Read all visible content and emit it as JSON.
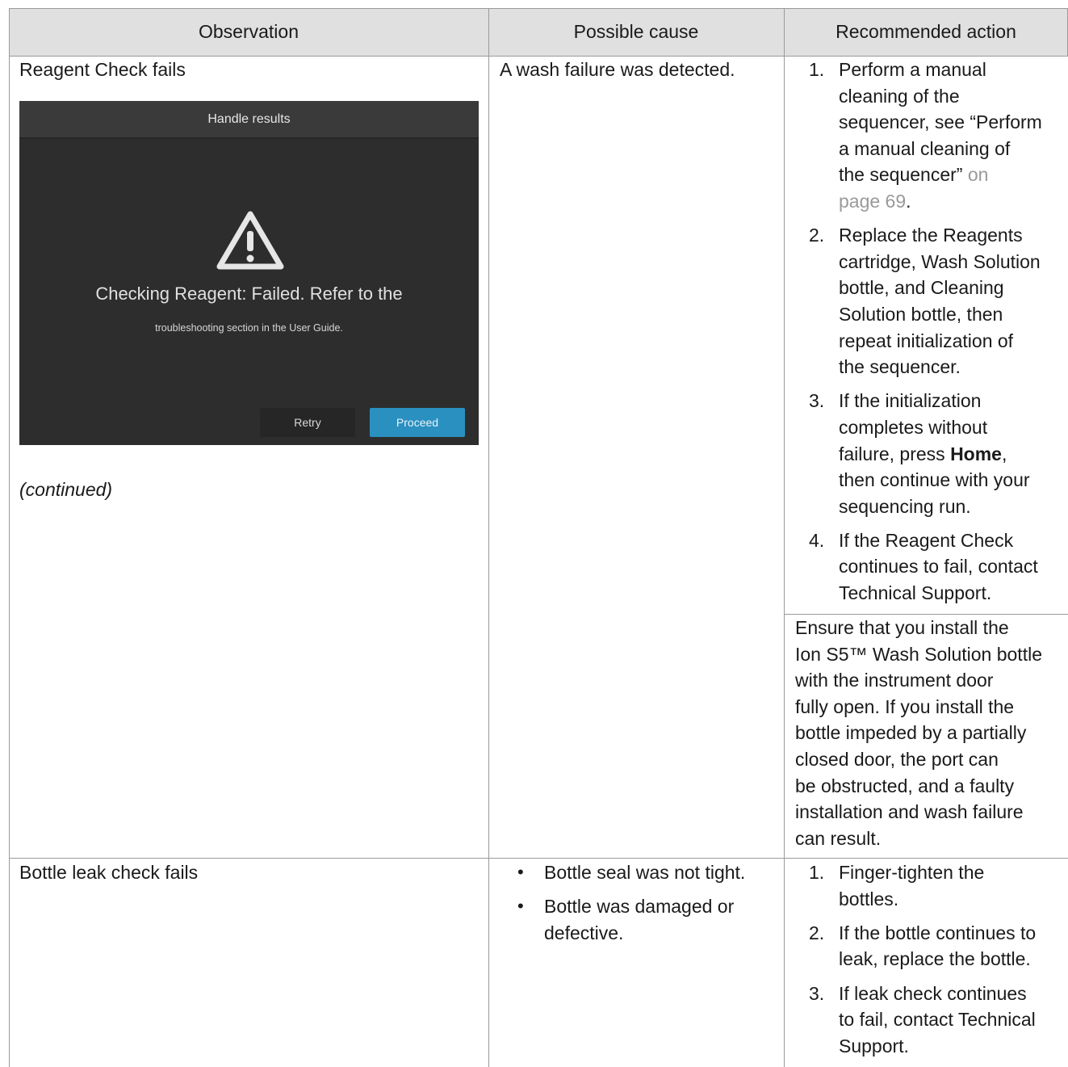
{
  "table": {
    "headers": [
      "Observation",
      "Possible cause",
      "Recommended action"
    ],
    "rows": [
      {
        "observation": "Reagent Check fails",
        "continued": "(continued)",
        "screenshot": {
          "title": "Handle results",
          "icon": "warning-triangle-icon",
          "message_line1": "Checking Reagent: Failed. Refer to the",
          "message_line2": "troubleshooting section in the User Guide.",
          "retry_label": "Retry",
          "proceed_label": "Proceed",
          "accent_color": "#2a90c0"
        },
        "cause": "A wash failure was detected.",
        "actions": [
          {
            "num": "1.",
            "lines": [
              "Perform a manual",
              "cleaning of the",
              "sequencer, see “Perform",
              "a manual cleaning of",
              "the sequencer”"
            ],
            "link_tail": " on",
            "link_line": "page 69",
            "end": "."
          },
          {
            "num": "2.",
            "lines": [
              "Replace the Reagents",
              "cartridge, Wash Solution",
              "bottle, and Cleaning",
              "Solution bottle, then",
              "repeat initialization of",
              "the sequencer."
            ]
          },
          {
            "num": "3.",
            "lines": [
              "If the initialization",
              "completes without"
            ],
            "line3_pre": "failure, press ",
            "line3_bold": "Home",
            "line3_post": ",",
            "lines_after": [
              "then continue with your",
              "sequencing run."
            ]
          },
          {
            "num": "4.",
            "lines": [
              "If the Reagent Check",
              "continues to fail, contact",
              "Technical Support."
            ]
          }
        ],
        "second_action": [
          "Ensure that you install the",
          "Ion S5™ Wash Solution bottle",
          "with the instrument door",
          "fully open. If you install the",
          "bottle impeded by a partially",
          "closed door, the port can",
          "be obstructed, and a faulty",
          "installation and wash failure",
          "can result."
        ]
      },
      {
        "observation": "Bottle leak check fails",
        "causes": [
          {
            "lines": [
              "Bottle seal was not tight."
            ]
          },
          {
            "lines": [
              "Bottle was damaged or",
              "defective."
            ]
          }
        ],
        "actions": [
          {
            "num": "1.",
            "lines": [
              "Finger-tighten the",
              "bottles."
            ]
          },
          {
            "num": "2.",
            "lines": [
              "If the bottle continues to",
              "leak, replace the bottle."
            ]
          },
          {
            "num": "3.",
            "lines": [
              "If leak check continues",
              "to fail, contact Technical",
              "Support."
            ]
          }
        ]
      }
    ]
  }
}
